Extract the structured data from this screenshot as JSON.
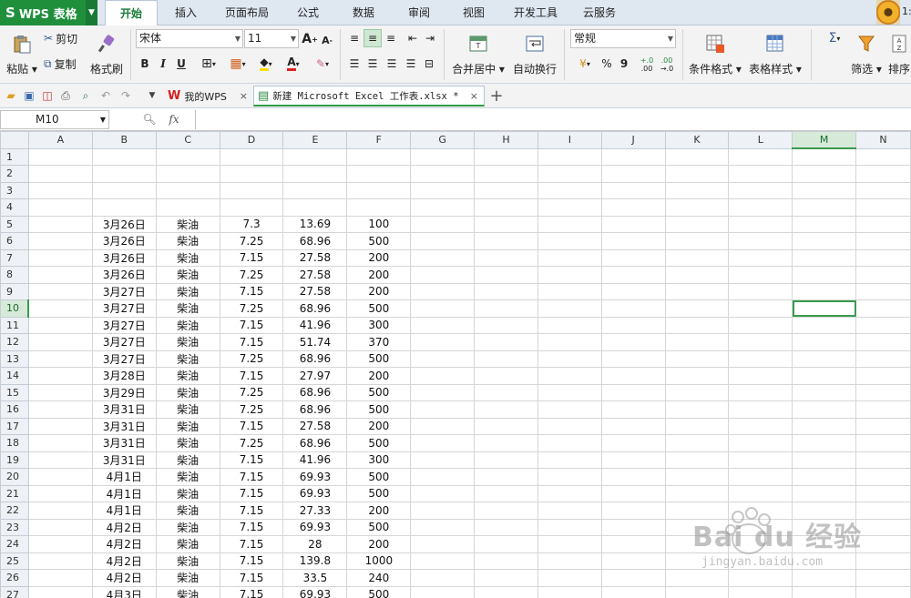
{
  "app": {
    "logo": "S",
    "name": "WPS 表格"
  },
  "menu": {
    "tabs": [
      "开始",
      "插入",
      "页面布局",
      "公式",
      "数据",
      "审阅",
      "视图",
      "开发工具",
      "云服务"
    ],
    "active": "开始"
  },
  "user": {
    "num": "1:"
  },
  "ribbon": {
    "paste": "粘贴",
    "cut": "剪切",
    "copy": "复制",
    "format_painter": "格式刷",
    "font_name": "宋体",
    "font_size": "11",
    "merge_center": "合并居中",
    "wrap_text": "自动换行",
    "number_format": "常规",
    "cond_format": "条件格式",
    "table_style": "表格样式",
    "filter": "筛选",
    "sort": "排序",
    "bold": "B",
    "italic": "I",
    "underline": "U",
    "font_color_letter": "A",
    "percent": "%",
    "comma": "9",
    "inc_dec1": "+.0",
    "inc_dec2": ".00",
    "dec_dec1": ".00",
    "dec_dec2": "→.0"
  },
  "quick_access": {
    "tabs": [
      {
        "label": "我的WPS",
        "icon": "wps-red-icon"
      },
      {
        "label": "新建 Microsoft Excel 工作表.xlsx *",
        "icon": "sheet-file-icon"
      }
    ]
  },
  "formula_bar": {
    "name_box": "M10",
    "fx": "fx",
    "value": ""
  },
  "sheet": {
    "columns": [
      "A",
      "B",
      "C",
      "D",
      "E",
      "F",
      "G",
      "H",
      "I",
      "J",
      "K",
      "L",
      "M",
      "N"
    ],
    "selected_cell": {
      "col": "M",
      "row": 10
    },
    "rows": [
      {
        "n": 1,
        "cells": [
          "",
          "",
          "",
          "",
          "",
          ""
        ]
      },
      {
        "n": 2,
        "cells": [
          "",
          "",
          "",
          "",
          "",
          ""
        ]
      },
      {
        "n": 3,
        "cells": [
          "",
          "",
          "",
          "",
          "",
          ""
        ]
      },
      {
        "n": 4,
        "cells": [
          "",
          "",
          "",
          "",
          "",
          ""
        ]
      },
      {
        "n": 5,
        "cells": [
          "",
          "3月26日",
          "柴油",
          "7.3",
          "13.69",
          "100"
        ]
      },
      {
        "n": 6,
        "cells": [
          "",
          "3月26日",
          "柴油",
          "7.25",
          "68.96",
          "500"
        ]
      },
      {
        "n": 7,
        "cells": [
          "",
          "3月26日",
          "柴油",
          "7.15",
          "27.58",
          "200"
        ]
      },
      {
        "n": 8,
        "cells": [
          "",
          "3月26日",
          "柴油",
          "7.25",
          "27.58",
          "200"
        ]
      },
      {
        "n": 9,
        "cells": [
          "",
          "3月27日",
          "柴油",
          "7.15",
          "27.58",
          "200"
        ]
      },
      {
        "n": 10,
        "cells": [
          "",
          "3月27日",
          "柴油",
          "7.25",
          "68.96",
          "500"
        ]
      },
      {
        "n": 11,
        "cells": [
          "",
          "3月27日",
          "柴油",
          "7.15",
          "41.96",
          "300"
        ]
      },
      {
        "n": 12,
        "cells": [
          "",
          "3月27日",
          "柴油",
          "7.15",
          "51.74",
          "370"
        ]
      },
      {
        "n": 13,
        "cells": [
          "",
          "3月27日",
          "柴油",
          "7.25",
          "68.96",
          "500"
        ]
      },
      {
        "n": 14,
        "cells": [
          "",
          "3月28日",
          "柴油",
          "7.15",
          "27.97",
          "200"
        ]
      },
      {
        "n": 15,
        "cells": [
          "",
          "3月29日",
          "柴油",
          "7.25",
          "68.96",
          "500"
        ]
      },
      {
        "n": 16,
        "cells": [
          "",
          "3月31日",
          "柴油",
          "7.25",
          "68.96",
          "500"
        ]
      },
      {
        "n": 17,
        "cells": [
          "",
          "3月31日",
          "柴油",
          "7.15",
          "27.58",
          "200"
        ]
      },
      {
        "n": 18,
        "cells": [
          "",
          "3月31日",
          "柴油",
          "7.25",
          "68.96",
          "500"
        ]
      },
      {
        "n": 19,
        "cells": [
          "",
          "3月31日",
          "柴油",
          "7.15",
          "41.96",
          "300"
        ]
      },
      {
        "n": 20,
        "cells": [
          "",
          "4月1日",
          "柴油",
          "7.15",
          "69.93",
          "500"
        ]
      },
      {
        "n": 21,
        "cells": [
          "",
          "4月1日",
          "柴油",
          "7.15",
          "69.93",
          "500"
        ]
      },
      {
        "n": 22,
        "cells": [
          "",
          "4月1日",
          "柴油",
          "7.15",
          "27.33",
          "200"
        ]
      },
      {
        "n": 23,
        "cells": [
          "",
          "4月2日",
          "柴油",
          "7.15",
          "69.93",
          "500"
        ]
      },
      {
        "n": 24,
        "cells": [
          "",
          "4月2日",
          "柴油",
          "7.15",
          "28",
          "200"
        ]
      },
      {
        "n": 25,
        "cells": [
          "",
          "4月2日",
          "柴油",
          "7.15",
          "139.8",
          "1000"
        ]
      },
      {
        "n": 26,
        "cells": [
          "",
          "4月2日",
          "柴油",
          "7.15",
          "33.5",
          "240"
        ]
      },
      {
        "n": 27,
        "cells": [
          "",
          "4月3日",
          "柴油",
          "7.15",
          "69.93",
          "500"
        ]
      }
    ]
  },
  "watermark": {
    "text": "Bai du 经验",
    "url": "jingyan.baidu.com"
  },
  "colors": {
    "accent": "#1f8f3c",
    "selection": "#3a9b4f",
    "header_bg": "#eef1f5"
  }
}
